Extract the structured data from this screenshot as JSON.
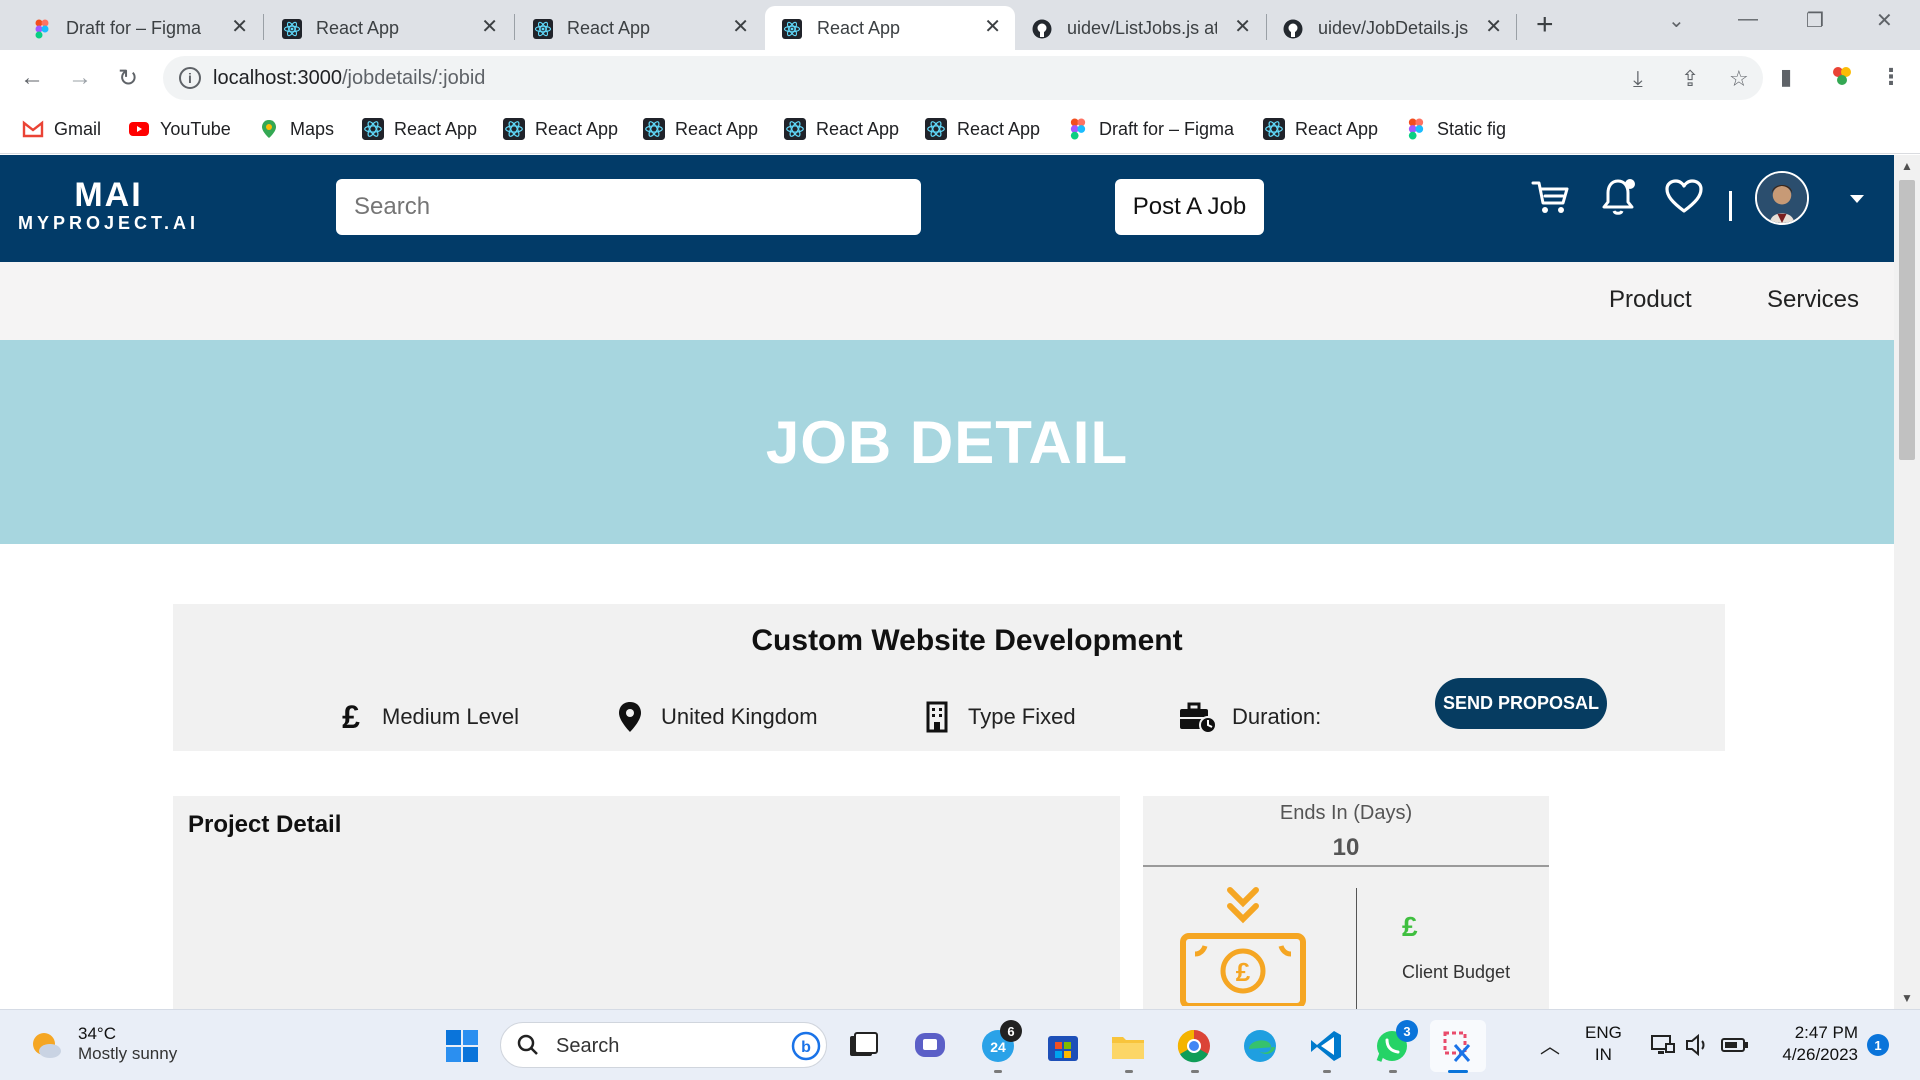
{
  "browser": {
    "tabs": [
      {
        "title": "Draft for – Figma",
        "icon": "figma-icon",
        "active": false
      },
      {
        "title": "React App",
        "icon": "react-icon",
        "active": false
      },
      {
        "title": "React App",
        "icon": "react-icon",
        "active": false
      },
      {
        "title": "React App",
        "icon": "react-icon",
        "active": true
      },
      {
        "title": "uidev/ListJobs.js at",
        "icon": "github-icon",
        "active": false
      },
      {
        "title": "uidev/JobDetails.js",
        "icon": "github-icon",
        "active": false
      }
    ],
    "url_host": "localhost:3000",
    "url_path": "/jobdetails/:jobid",
    "bookmarks": [
      {
        "label": "Gmail",
        "icon": "gmail-icon"
      },
      {
        "label": "YouTube",
        "icon": "youtube-icon"
      },
      {
        "label": "Maps",
        "icon": "maps-icon"
      },
      {
        "label": "React App",
        "icon": "react-icon"
      },
      {
        "label": "React App",
        "icon": "react-icon"
      },
      {
        "label": "React App",
        "icon": "react-icon"
      },
      {
        "label": "React App",
        "icon": "react-icon"
      },
      {
        "label": "React App",
        "icon": "react-icon"
      },
      {
        "label": "Draft for – Figma",
        "icon": "figma-icon"
      },
      {
        "label": "React App",
        "icon": "react-icon"
      },
      {
        "label": "Static fig",
        "icon": "figma-icon"
      }
    ]
  },
  "site": {
    "logo_mark": "MAI",
    "logo_name": "MYPROJECT.AI",
    "search_placeholder": "Search",
    "post_job_label": "Post A Job",
    "nav": [
      "Product",
      "Services"
    ],
    "banner_title": "JOB DETAIL",
    "brand_color": "#023b68",
    "banner_color": "#a7d6df"
  },
  "job": {
    "title": "Custom Website Development",
    "level": "Medium Level",
    "location": "United Kingdom",
    "type": "Type Fixed",
    "duration_label": "Duration:",
    "send_proposal_label": "SEND PROPOSAL",
    "project_detail_title": "Project Detail",
    "ends_in_label": "Ends In (Days)",
    "ends_in_value": "10",
    "pound_symbol": "£",
    "client_budget_label": "Client Budget"
  },
  "taskbar": {
    "temperature": "34°C",
    "weather": "Mostly sunny",
    "search_label": "Search",
    "lang_line1": "ENG",
    "lang_line2": "IN",
    "time": "2:47 PM",
    "date": "4/26/2023",
    "badges": {
      "calendar": "6",
      "whatsapp": "3",
      "notifications": "1"
    },
    "calendar_day": "24"
  }
}
